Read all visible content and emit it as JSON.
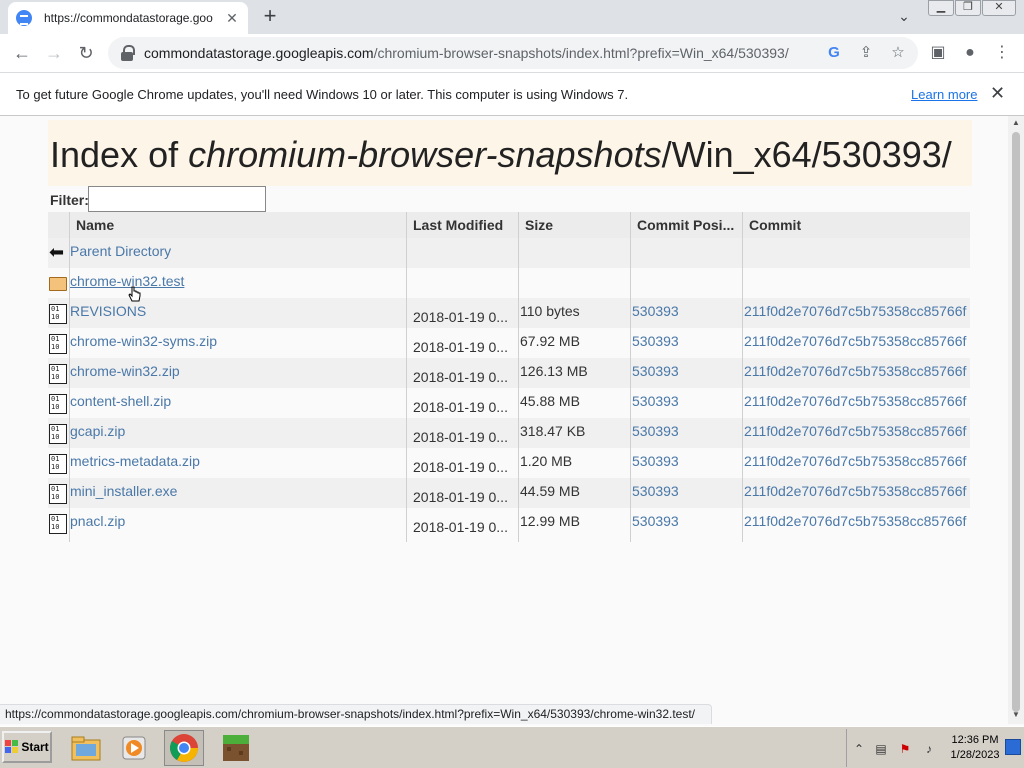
{
  "browser": {
    "tab_title": "https://commondatastorage.goo",
    "tab_close": "✕",
    "new_tab": "+",
    "url_host": "commondatastorage.googleapis.com",
    "url_path": "/chromium-browser-snapshots/index.html?prefix=Win_x64/530393/"
  },
  "infobar": {
    "message": "To get future Google Chrome updates, you'll need Windows 10 or later. This computer is using Windows 7.",
    "learn_more": "Learn more",
    "close": "✕"
  },
  "page": {
    "heading_prefix": "Index of ",
    "heading_italic": "chromium-browser-snapshots",
    "heading_suffix": "/Win_x64/530393/",
    "filter_label": "Filter:",
    "filter_value": "",
    "columns": [
      "Name",
      "Last Modified",
      "Size",
      "Commit Posi...",
      "Commit"
    ],
    "rows": [
      {
        "icon": "parent",
        "name": "Parent Directory",
        "modified": "",
        "size": "",
        "position": "",
        "commit": ""
      },
      {
        "icon": "folder",
        "name": "chrome-win32.test",
        "modified": "",
        "size": "",
        "position": "",
        "commit": ""
      },
      {
        "icon": "file",
        "name": "REVISIONS",
        "modified": "2018-01-19 0...",
        "size": "110 bytes",
        "position": "530393",
        "commit": "211f0d2e7076d7c5b75358cc85766f"
      },
      {
        "icon": "file",
        "name": "chrome-win32-syms.zip",
        "modified": "2018-01-19 0...",
        "size": "67.92 MB",
        "position": "530393",
        "commit": "211f0d2e7076d7c5b75358cc85766f"
      },
      {
        "icon": "file",
        "name": "chrome-win32.zip",
        "modified": "2018-01-19 0...",
        "size": "126.13 MB",
        "position": "530393",
        "commit": "211f0d2e7076d7c5b75358cc85766f"
      },
      {
        "icon": "file",
        "name": "content-shell.zip",
        "modified": "2018-01-19 0...",
        "size": "45.88 MB",
        "position": "530393",
        "commit": "211f0d2e7076d7c5b75358cc85766f"
      },
      {
        "icon": "file",
        "name": "gcapi.zip",
        "modified": "2018-01-19 0...",
        "size": "318.47 KB",
        "position": "530393",
        "commit": "211f0d2e7076d7c5b75358cc85766f"
      },
      {
        "icon": "file",
        "name": "metrics-metadata.zip",
        "modified": "2018-01-19 0...",
        "size": "1.20 MB",
        "position": "530393",
        "commit": "211f0d2e7076d7c5b75358cc85766f"
      },
      {
        "icon": "file",
        "name": "mini_installer.exe",
        "modified": "2018-01-19 0...",
        "size": "44.59 MB",
        "position": "530393",
        "commit": "211f0d2e7076d7c5b75358cc85766f"
      },
      {
        "icon": "file",
        "name": "pnacl.zip",
        "modified": "2018-01-19 0...",
        "size": "12.99 MB",
        "position": "530393",
        "commit": "211f0d2e7076d7c5b75358cc85766f"
      }
    ]
  },
  "status_url": "https://commondatastorage.googleapis.com/chromium-browser-snapshots/index.html?prefix=Win_x64/530393/chrome-win32.test/",
  "taskbar": {
    "start_label": "Start",
    "clock_time": "12:36 PM",
    "clock_date": "1/28/2023"
  },
  "colors": {
    "link": "#4a78a8",
    "heading_band": "#fdf5e8",
    "accent": "#1a73e8"
  }
}
